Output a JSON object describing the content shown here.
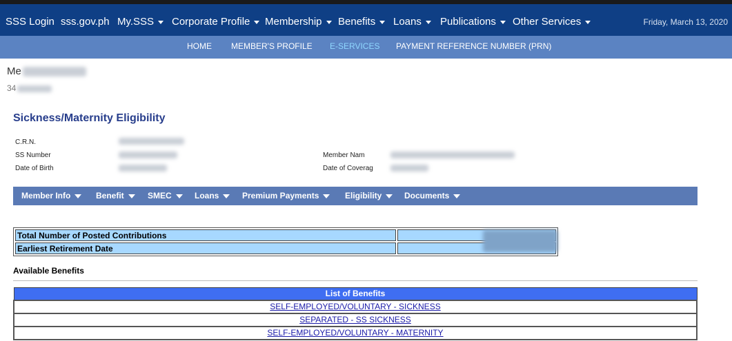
{
  "topnav": {
    "items": [
      {
        "label": "SSS Login",
        "dropdown": false
      },
      {
        "label": "sss.gov.ph",
        "dropdown": false
      },
      {
        "label": "My.SSS",
        "dropdown": true
      },
      {
        "label": "Corporate Profile",
        "dropdown": true
      },
      {
        "label": "Membership",
        "dropdown": true
      },
      {
        "label": "Benefits",
        "dropdown": true
      },
      {
        "label": "Loans",
        "dropdown": true
      },
      {
        "label": "Publications",
        "dropdown": true
      },
      {
        "label": "Other Services",
        "dropdown": true
      }
    ],
    "date": "Friday, March 13, 2020"
  },
  "subnav": {
    "items": [
      "HOME",
      "MEMBER'S PROFILE",
      "E-SERVICES",
      "PAYMENT REFERENCE NUMBER (PRN)"
    ],
    "active": "E-SERVICES"
  },
  "member": {
    "name_visible": "Me",
    "id_visible": "34"
  },
  "page": {
    "title": "Sickness/Maternity Eligibility"
  },
  "info": {
    "crn_label": "C.R.N.",
    "ss_number_label": "SS Number",
    "dob_label": "Date of Birth",
    "member_name_label": "Member Nam",
    "coverage_label": "Date of Coverag"
  },
  "menu": {
    "items": [
      "Member Info",
      "Benefit",
      "SMEC",
      "Loans",
      "Premium Payments",
      "Eligibility",
      "Documents"
    ]
  },
  "contributions": {
    "rows": [
      "Total Number of Posted Contributions",
      "Earliest Retirement Date"
    ]
  },
  "available": {
    "heading": "Available Benefits",
    "table_header": "List of Benefits",
    "benefits": [
      "SELF-EMPLOYED/VOLUNTARY - SICKNESS",
      "SEPARATED - SS SICKNESS",
      "SELF-EMPLOYED/VOLUNTARY - MATERNITY"
    ]
  },
  "colors": {
    "topnav_bg": "#0f3f85",
    "subnav_bg": "#5b83c2",
    "active_subnav": "#8fd7ff",
    "menubar_bg": "#5a7ab5",
    "table_cell_bg": "#a7d8ff",
    "benefits_header_bg": "#3f6ef2"
  }
}
